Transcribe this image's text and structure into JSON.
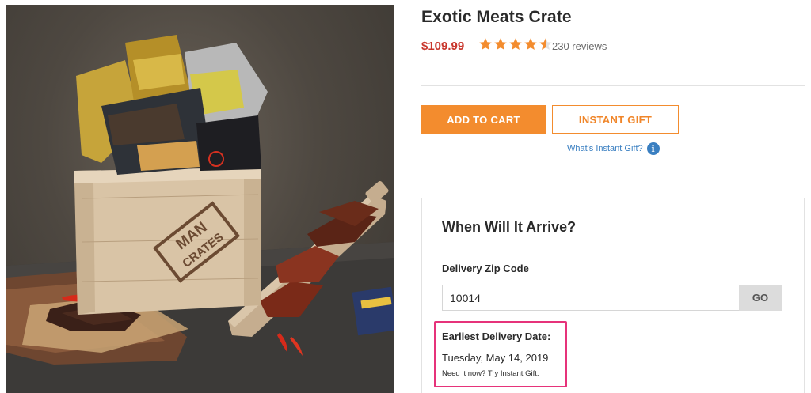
{
  "product": {
    "title": "Exotic Meats Crate",
    "price": "$109.99",
    "rating": 4.5,
    "rating_max": 5,
    "reviews": "230 reviews",
    "image_icon": "product-photo-meat-crate"
  },
  "actions": {
    "add_to_cart": "ADD TO CART",
    "instant_gift": "INSTANT GIFT",
    "whats_instant_gift": "What's Instant Gift?",
    "info_icon_glyph": "i"
  },
  "delivery": {
    "title": "When Will It Arrive?",
    "zip_label": "Delivery Zip Code",
    "zip_value": "10014",
    "go_label": "GO",
    "earliest_label": "Earliest Delivery Date:",
    "earliest_date": "Tuesday, May 14, 2019",
    "need_it_now": "Need it now? Try Instant Gift."
  },
  "photo": {
    "crate_stamp": "MAN CRATES"
  },
  "colors": {
    "accent_orange": "#f38c2e",
    "price_red": "#c8352b",
    "link_blue": "#3a7fc1",
    "highlight_pink": "#e6337a"
  }
}
